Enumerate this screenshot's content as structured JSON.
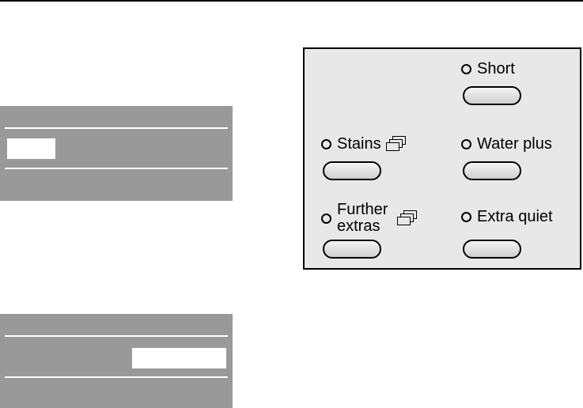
{
  "control_panel": {
    "options": [
      {
        "id": "short",
        "label": "Short"
      },
      {
        "id": "stains",
        "label": "Stains"
      },
      {
        "id": "water-plus",
        "label": "Water plus"
      },
      {
        "id": "further-extras",
        "label": "Further extras"
      },
      {
        "id": "extra-quiet",
        "label": "Extra quiet"
      }
    ]
  },
  "icons": {
    "led": "indicator-led-icon",
    "submenu": "stacked-pages-icon"
  },
  "colors": {
    "display_grey": "#999999",
    "panel_background": "#e8e8e8"
  }
}
